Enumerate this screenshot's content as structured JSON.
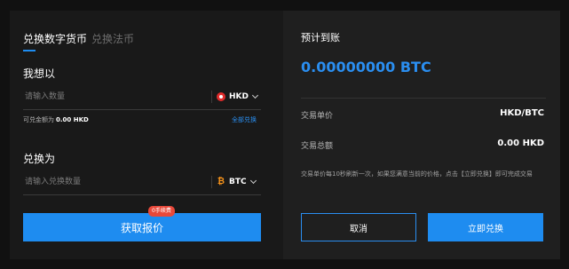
{
  "tabs": [
    {
      "label": "兑换数字货币",
      "active": true
    },
    {
      "label": "兑换法币",
      "active": false
    }
  ],
  "from": {
    "label": "我想以",
    "placeholder": "请输入数量",
    "currency": "HKD",
    "currency_icon": "hk-flag-icon",
    "available_prefix": "可兑金额为",
    "available_amount": "0.00 HKD",
    "all_label": "全部兑换"
  },
  "to": {
    "label": "兑换为",
    "placeholder": "请输入兑换数量",
    "currency": "BTC",
    "currency_icon": "btc-icon"
  },
  "quote": {
    "button_label": "获取报价",
    "fee_badge": "0手续费"
  },
  "summary": {
    "title": "预计到账",
    "amount": "0.00000000 BTC",
    "rows": [
      {
        "label": "交易单价",
        "value": "HKD/BTC"
      },
      {
        "label": "交易总额",
        "value": "0.00 HKD"
      }
    ],
    "note": "交易单价每10秒刷新一次，如果您满意当前的价格，点击【立即兑换】即可完成交易",
    "cancel_label": "取消",
    "exchange_label": "立即兑换"
  },
  "colors": {
    "accent": "#1e8cf0",
    "badge": "#e8483a",
    "background": "#111111"
  }
}
